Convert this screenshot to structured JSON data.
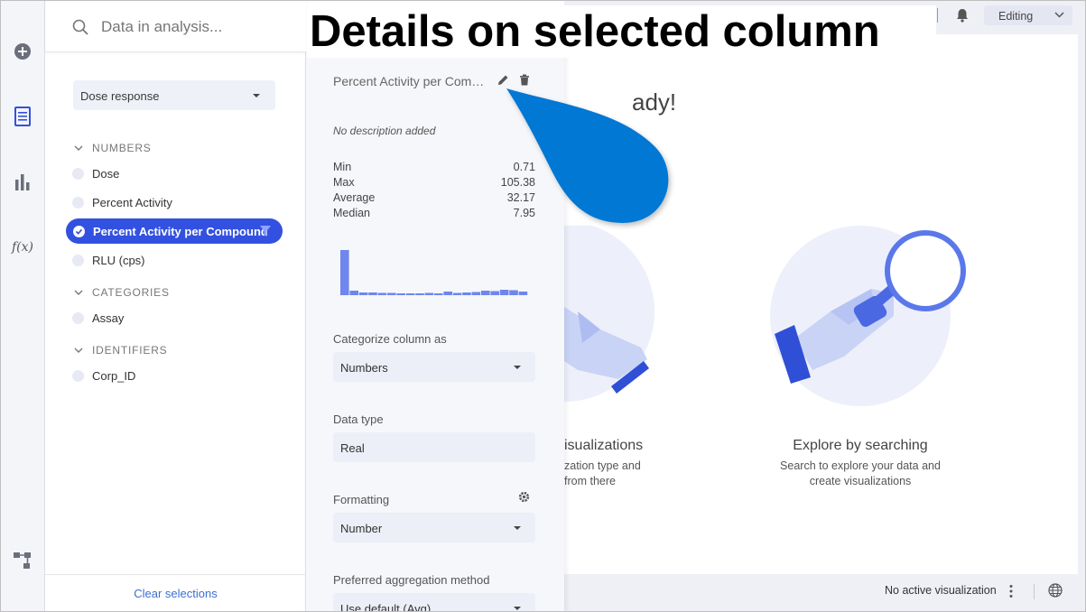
{
  "callout": {
    "title": "Details on selected column"
  },
  "rail": {
    "icons": [
      "add-icon",
      "data-icon",
      "visualization-icon",
      "function-icon",
      "data-canvas-icon"
    ]
  },
  "data_panel": {
    "search_placeholder": "Data in analysis...",
    "dataset": "Dose response",
    "groups": [
      {
        "label": "NUMBERS",
        "items": [
          "Dose",
          "Percent Activity",
          "Percent Activity per Compound",
          "RLU (cps)"
        ]
      },
      {
        "label": "CATEGORIES",
        "items": [
          "Assay"
        ]
      },
      {
        "label": "IDENTIFIERS",
        "items": [
          "Corp_ID"
        ]
      }
    ],
    "selected_item": "Percent Activity per Compound",
    "clear_label": "Clear selections"
  },
  "details": {
    "column_name": "Percent Activity per Compound",
    "description": "No description added",
    "stats": [
      {
        "label": "Min",
        "value": "0.71"
      },
      {
        "label": "Max",
        "value": "105.38"
      },
      {
        "label": "Average",
        "value": "32.17"
      },
      {
        "label": "Median",
        "value": "7.95"
      }
    ],
    "histogram_relative_heights": [
      1.0,
      0.1,
      0.06,
      0.06,
      0.05,
      0.05,
      0.04,
      0.03,
      0.03,
      0.05,
      0.03,
      0.08,
      0.05,
      0.06,
      0.07,
      0.1,
      0.09,
      0.12,
      0.11,
      0.08
    ],
    "categorize_label": "Categorize column as",
    "categorize_value": "Numbers",
    "datatype_label": "Data type",
    "datatype_value": "Real",
    "formatting_label": "Formatting",
    "formatting_value": "Number",
    "aggregation_label": "Preferred aggregation method",
    "aggregation_value": "Use default (Avg)"
  },
  "main": {
    "ready_title_visible": "ady!",
    "card_left_title": "isualizations",
    "card_left_sub_line1": "zation type and",
    "card_left_sub_line2": "from there",
    "card_right_title": "Explore by searching",
    "card_right_sub_line1": "Search to explore your data and",
    "card_right_sub_line2": "create visualizations",
    "editing_label": "Editing",
    "status": "No active visualization",
    "accent": "#3351e0",
    "callout_color": "#0078d4"
  }
}
